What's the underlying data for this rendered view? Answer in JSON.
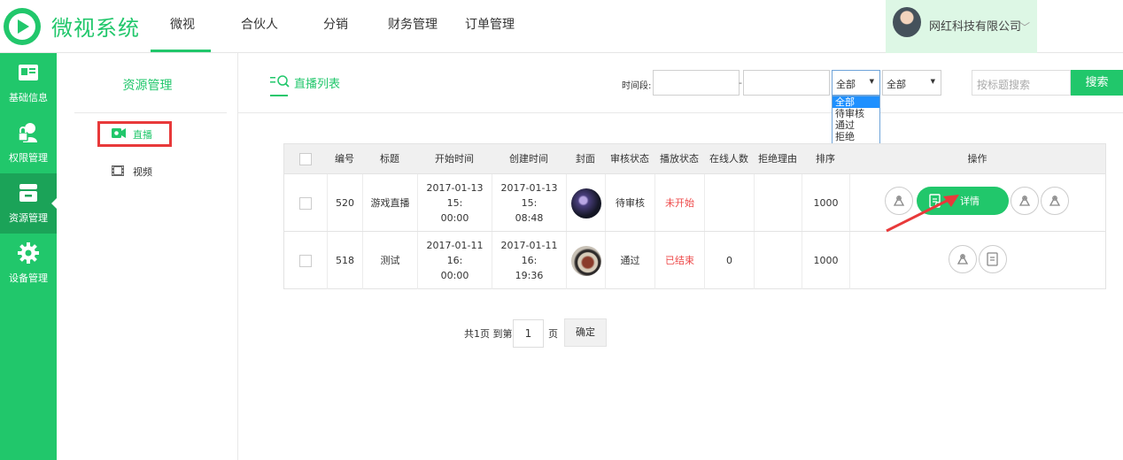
{
  "app": {
    "logo_text": "微视系统"
  },
  "nav": {
    "items": [
      "微视",
      "合伙人",
      "分销",
      "财务管理",
      "订单管理"
    ],
    "active": "微视"
  },
  "user": {
    "name": "网红科技有限公司",
    "chevron": "﹀"
  },
  "sidebar": {
    "items": [
      {
        "label": "基础信息",
        "icon": "id-card-icon"
      },
      {
        "label": "权限管理",
        "icon": "user-lock-icon"
      },
      {
        "label": "资源管理",
        "icon": "drawer-icon",
        "active": true
      },
      {
        "label": "设备管理",
        "icon": "gear-icon"
      }
    ]
  },
  "subnav": {
    "title": "资源管理",
    "items": [
      {
        "label": "直播",
        "icon": "live-camera-icon",
        "active": true
      },
      {
        "label": "视频",
        "icon": "film-icon"
      }
    ]
  },
  "page": {
    "tab_label": "直播列表"
  },
  "filters": {
    "time_label": "时间段:",
    "start_value": "",
    "dash": "-",
    "end_value": "",
    "status_select": {
      "value": "全部",
      "options": [
        "全部",
        "待审核",
        "通过",
        "拒绝"
      ],
      "open": true
    },
    "play_select": {
      "value": "全部"
    },
    "search_placeholder": "按标题搜索",
    "search_button": "搜索"
  },
  "table": {
    "headers": [
      "编号",
      "标题",
      "开始时间",
      "创建时间",
      "封面",
      "审核状态",
      "播放状态",
      "在线人数",
      "拒绝理由",
      "排序",
      "操作"
    ],
    "rows": [
      {
        "id": "520",
        "title": "游戏直播",
        "start_time_1": "2017-01-13 15:",
        "start_time_2": "00:00",
        "created_time_1": "2017-01-13 15:",
        "created_time_2": "08:48",
        "review_status": "待审核",
        "play_status": "未开始",
        "online": "",
        "reject_reason": "",
        "sort": "1000",
        "detail_label": "详情"
      },
      {
        "id": "518",
        "title": "测试",
        "start_time_1": "2017-01-11 16:",
        "start_time_2": "00:00",
        "created_time_1": "2017-01-11 16:",
        "created_time_2": "19:36",
        "review_status": "通过",
        "play_status": "已结束",
        "online": "0",
        "reject_reason": "",
        "sort": "1000"
      }
    ]
  },
  "pagination": {
    "total_text": "共1页 到第",
    "page": "1",
    "page_suffix": "页",
    "confirm": "确定"
  },
  "colors": {
    "accent": "#21c76b",
    "accent_dark": "#1ba358",
    "status_red": "#ee4a4a",
    "highlight_red": "#e8393a"
  }
}
